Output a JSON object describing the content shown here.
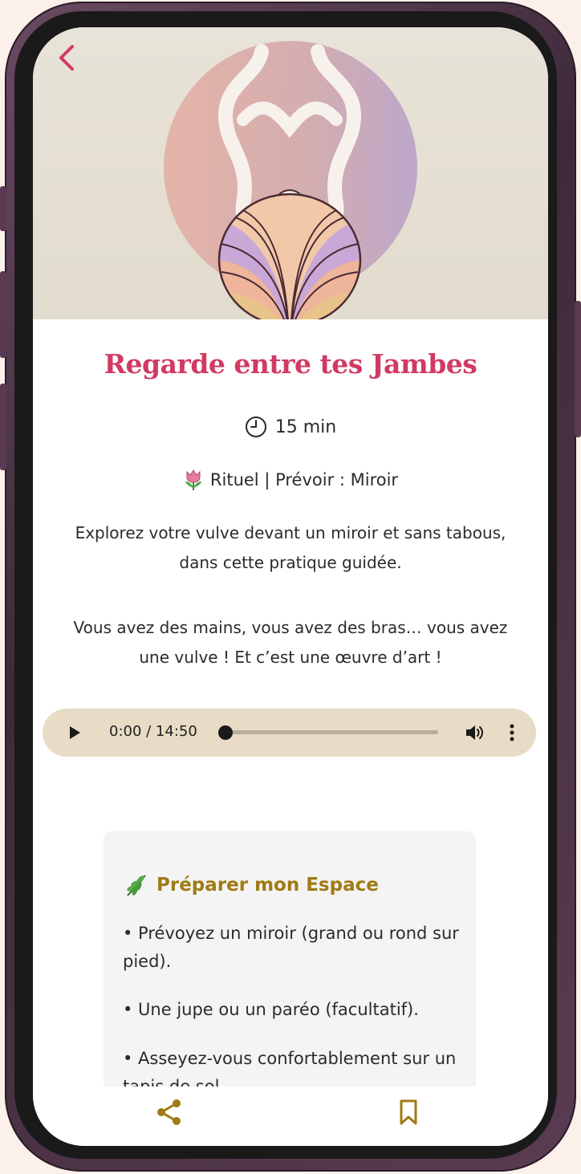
{
  "colors": {
    "accent": "#d13a63",
    "card_title": "#a07a14",
    "audio_bg": "#e8dcc6",
    "icon_gold": "#a07a14"
  },
  "header": {
    "back_icon": "chevron-left-icon"
  },
  "content": {
    "title": "Regarde entre tes Jambes",
    "duration_icon": "clock-icon",
    "duration": "15 min",
    "meta_icon": "tulip-icon",
    "meta": "Rituel | Prévoir : Miroir",
    "description_1": "Explorez votre vulve devant un miroir et sans tabous, dans cette pratique guidée.",
    "description_2": "Vous avez des mains, vous avez des bras… vous avez une vulve ! Et c’est une œuvre d’art !"
  },
  "audio": {
    "time": "0:00 / 14:50",
    "progress": 0
  },
  "prepare": {
    "icon": "herb-icon",
    "title": "Préparer mon Espace",
    "items": [
      "• Prévoyez un miroir (grand ou rond sur pied).",
      "• Une jupe ou un paréo (facultatif).",
      "• Asseyez-vous confortablement sur un tapis de sol."
    ]
  },
  "bottom_bar": {
    "share_icon": "share-icon",
    "bookmark_icon": "bookmark-icon"
  }
}
